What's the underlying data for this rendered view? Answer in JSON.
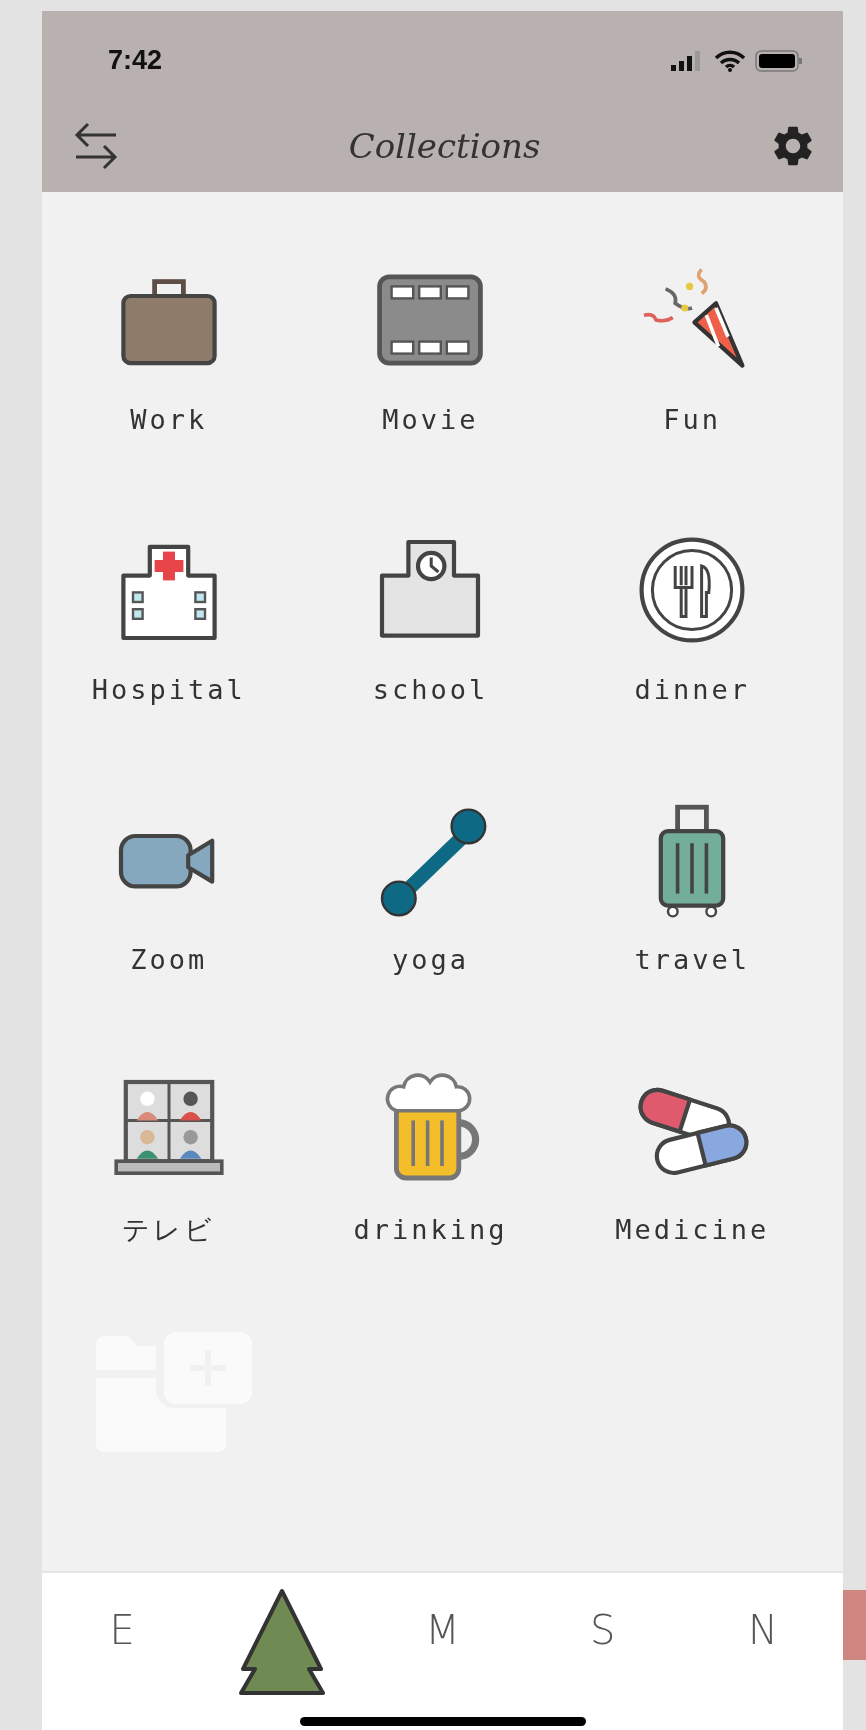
{
  "status_bar": {
    "time": "7:42"
  },
  "nav": {
    "title": "Collections"
  },
  "collections": [
    {
      "label": "Work"
    },
    {
      "label": "Movie"
    },
    {
      "label": "Fun"
    },
    {
      "label": "Hospital"
    },
    {
      "label": "school"
    },
    {
      "label": "dinner"
    },
    {
      "label": "Zoom"
    },
    {
      "label": "yoga"
    },
    {
      "label": "travel"
    },
    {
      "label": "テレビ"
    },
    {
      "label": "drinking"
    },
    {
      "label": "Medicine"
    }
  ],
  "tabs": [
    {
      "kind": "letter",
      "label": "E",
      "selected": false
    },
    {
      "kind": "tree",
      "selected": true
    },
    {
      "kind": "letter",
      "label": "M",
      "selected": false
    },
    {
      "kind": "letter",
      "label": "S",
      "selected": false
    },
    {
      "kind": "letter",
      "label": "N",
      "selected": false
    }
  ]
}
